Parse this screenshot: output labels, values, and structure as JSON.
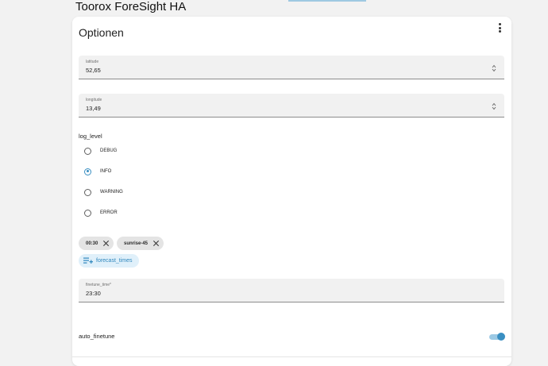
{
  "app": {
    "title": "Toorox ForeSight HA"
  },
  "card": {
    "title": "Optionen",
    "menu_icon": "dots-vertical-icon"
  },
  "fields": {
    "latitude": {
      "label": "latitude",
      "value": "52,65"
    },
    "longitude": {
      "label": "longitude",
      "value": "13,49"
    },
    "finetune_time": {
      "label": "finetune_time*",
      "value": "23:30"
    }
  },
  "log_level": {
    "label": "log_level",
    "selected": "INFO",
    "options": [
      "DEBUG",
      "INFO",
      "WARNING",
      "ERROR"
    ]
  },
  "forecast_times": {
    "chips": [
      "00:30",
      "sunrise-45"
    ],
    "add_label": "forecast_times",
    "add_icon": "playlist-plus-icon"
  },
  "auto_finetune": {
    "label": "auto_finetune",
    "enabled": true
  },
  "colors": {
    "accent": "#3a8fc2",
    "accent_light": "#9cc9e4",
    "chip_bg": "#e4e4e4",
    "field_bg": "#f1f1f1"
  }
}
